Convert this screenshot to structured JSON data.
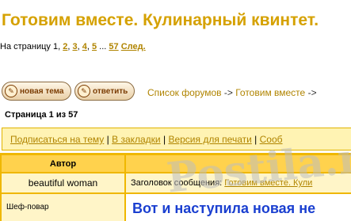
{
  "page_title": "Готовим вместе. Кулинарный квинтет.",
  "pagination": {
    "label": "На страницу",
    "current": "1",
    "pages": [
      "2",
      "3",
      "4",
      "5"
    ],
    "ellipsis": "...",
    "last": "57",
    "next": "След."
  },
  "buttons": {
    "new_topic": "новая тема",
    "reply": "ответить"
  },
  "breadcrumbs": {
    "forum_list": "Список форумов",
    "arrow": "->",
    "category": "Готовим вместе",
    "trail": "->"
  },
  "page_of": "Страница 1 из 57",
  "toolbar": {
    "subscribe": "Подписаться на тему",
    "bookmarks": "В закладки",
    "print": "Версия для печати",
    "more": "Сооб",
    "separator": "|"
  },
  "table": {
    "author_header": "Автор",
    "author": "beautiful woman",
    "rank": "Шеф-повар",
    "subject_label": "Заголовок сообщения:",
    "subject_link": "Готовим вместе. Кули",
    "body": "Вот и наступила новая не"
  },
  "watermark": "Postila.ru"
}
